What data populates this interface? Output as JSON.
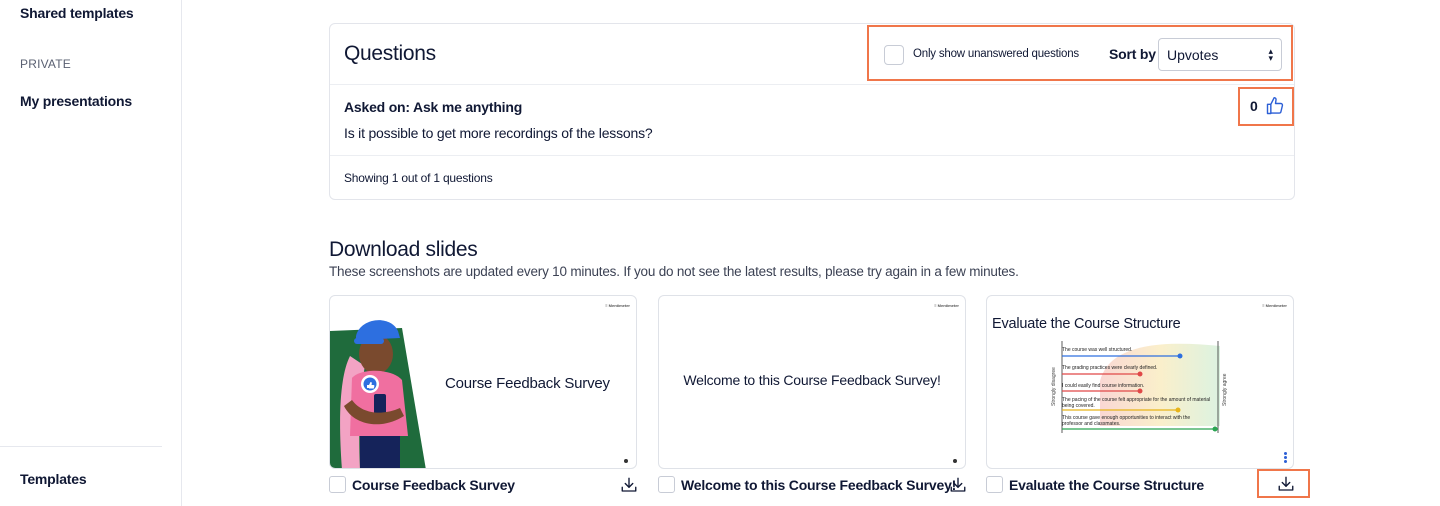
{
  "sidebar": {
    "shared_templates": "Shared templates",
    "private_label": "PRIVATE",
    "my_presentations": "My presentations",
    "templates": "Templates"
  },
  "questions": {
    "title": "Questions",
    "filter_label": "Only show unanswered questions",
    "filter_checked": false,
    "sort_label": "Sort by",
    "sort_value": "Upvotes",
    "items": [
      {
        "asked_on": "Asked on: Ask me anything",
        "text": "Is it possible to get more recordings of the lessons?",
        "upvotes": "0"
      }
    ],
    "footer": "Showing 1 out of 1 questions"
  },
  "download": {
    "title": "Download slides",
    "subtitle": "These screenshots are updated every 10 minutes. If you do not see the latest results, please try again in a few minutes.",
    "slides": [
      {
        "caption": "Course Feedback Survey",
        "thumb_title": "Course Feedback Survey"
      },
      {
        "caption": "Welcome to this Course Feedback Survey!",
        "thumb_title": "Welcome to this Course Feedback Survey!"
      },
      {
        "caption": "Evaluate the Course Structure",
        "thumb_title": "Evaluate the Course Structure"
      }
    ],
    "slide3_scale": {
      "left": "Strongly disagree",
      "right": "Strongly agree",
      "statements": [
        "The course was well structured.",
        "The grading practices were clearly defined.",
        "I could easily find course information.",
        "The pacing of the course felt appropriate for the amount of material being covered.",
        "This course gave enough opportunities to interact with the professor and classmates."
      ]
    },
    "brand_mark": "Mentimeter"
  },
  "colors": {
    "highlight": "#f0764a",
    "text": "#101834",
    "thumb_accent": "#2c5fd6"
  }
}
